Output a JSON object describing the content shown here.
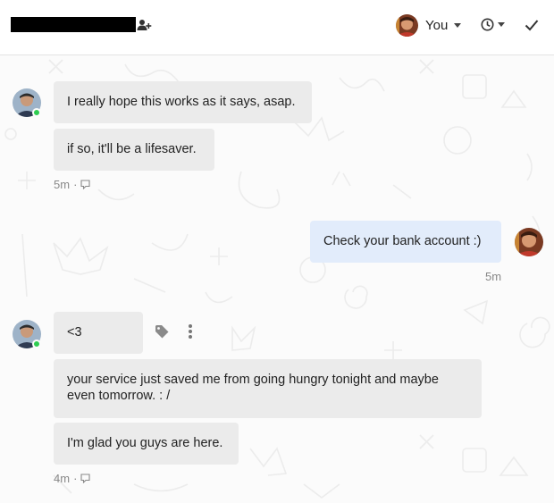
{
  "header": {
    "assignee_label": "You"
  },
  "messages": [
    {
      "text": "I really hope this works as it says, asap."
    },
    {
      "text": "if so, it'll be a lifesaver."
    },
    {
      "text": "Check your bank account :)"
    },
    {
      "text": "<3"
    },
    {
      "text": "your service just saved me from going hungry tonight and maybe even tomorrow. : /"
    },
    {
      "text": "I'm glad you guys are here."
    }
  ],
  "meta": {
    "group1_time": "5m",
    "outgoing_time": "5m",
    "group2_time": "4m",
    "separator": "·"
  },
  "colors": {
    "incoming_bubble": "#ebebeb",
    "outgoing_bubble": "#e2ecfb",
    "online": "#2ecc51"
  }
}
